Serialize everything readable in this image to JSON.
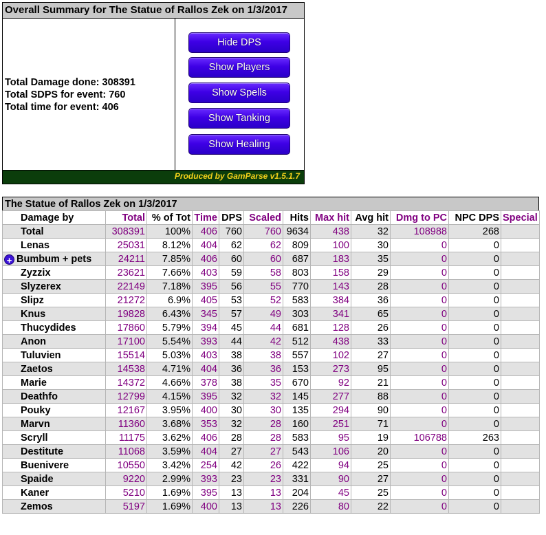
{
  "summary": {
    "title": "Overall Summary for The Statue of Rallos Zek on 1/3/2017",
    "stats": {
      "total_damage": "Total Damage done: 308391",
      "total_sdps": "Total SDPS for event: 760",
      "total_time": "Total time for event: 406"
    },
    "buttons": {
      "hide_dps": "Hide DPS",
      "show_players": "Show Players",
      "show_spells": "Show Spells",
      "show_tanking": "Show Tanking",
      "show_healing": "Show Healing"
    },
    "footer": "Produced by GamParse v1.5.1.7"
  },
  "table": {
    "title": "The Statue of Rallos Zek on 1/3/2017",
    "headers": {
      "damage_by": "Damage by",
      "total": "Total",
      "pct": "% of Tot",
      "time": "Time",
      "dps": "DPS",
      "scaled": "Scaled",
      "hits": "Hits",
      "max_hit": "Max hit",
      "avg_hit": "Avg hit",
      "dmg_to_pc": "Dmg to PC",
      "npc_dps": "NPC DPS",
      "special": "Special"
    },
    "rows": [
      {
        "name": "Total",
        "total": "308391",
        "pct": "100%",
        "time": "406",
        "dps": "760",
        "scaled": "760",
        "hits": "9634",
        "max": "438",
        "avg": "32",
        "dmgpc": "108988",
        "npcdps": "268",
        "special": ""
      },
      {
        "name": "Lenas",
        "total": "25031",
        "pct": "8.12%",
        "time": "404",
        "dps": "62",
        "scaled": "62",
        "hits": "809",
        "max": "100",
        "avg": "30",
        "dmgpc": "0",
        "npcdps": "0",
        "special": ""
      },
      {
        "name": "Bumbum + pets",
        "total": "24211",
        "pct": "7.85%",
        "time": "406",
        "dps": "60",
        "scaled": "60",
        "hits": "687",
        "max": "183",
        "avg": "35",
        "dmgpc": "0",
        "npcdps": "0",
        "special": "",
        "expand": "+"
      },
      {
        "name": "Zyzzix",
        "total": "23621",
        "pct": "7.66%",
        "time": "403",
        "dps": "59",
        "scaled": "58",
        "hits": "803",
        "max": "158",
        "avg": "29",
        "dmgpc": "0",
        "npcdps": "0",
        "special": ""
      },
      {
        "name": "Slyzerex",
        "total": "22149",
        "pct": "7.18%",
        "time": "395",
        "dps": "56",
        "scaled": "55",
        "hits": "770",
        "max": "143",
        "avg": "28",
        "dmgpc": "0",
        "npcdps": "0",
        "special": ""
      },
      {
        "name": "Slipz",
        "total": "21272",
        "pct": "6.9%",
        "time": "405",
        "dps": "53",
        "scaled": "52",
        "hits": "583",
        "max": "384",
        "avg": "36",
        "dmgpc": "0",
        "npcdps": "0",
        "special": ""
      },
      {
        "name": "Knus",
        "total": "19828",
        "pct": "6.43%",
        "time": "345",
        "dps": "57",
        "scaled": "49",
        "hits": "303",
        "max": "341",
        "avg": "65",
        "dmgpc": "0",
        "npcdps": "0",
        "special": ""
      },
      {
        "name": "Thucydides",
        "total": "17860",
        "pct": "5.79%",
        "time": "394",
        "dps": "45",
        "scaled": "44",
        "hits": "681",
        "max": "128",
        "avg": "26",
        "dmgpc": "0",
        "npcdps": "0",
        "special": ""
      },
      {
        "name": "Anon",
        "total": "17100",
        "pct": "5.54%",
        "time": "393",
        "dps": "44",
        "scaled": "42",
        "hits": "512",
        "max": "438",
        "avg": "33",
        "dmgpc": "0",
        "npcdps": "0",
        "special": ""
      },
      {
        "name": "Tuluvien",
        "total": "15514",
        "pct": "5.03%",
        "time": "403",
        "dps": "38",
        "scaled": "38",
        "hits": "557",
        "max": "102",
        "avg": "27",
        "dmgpc": "0",
        "npcdps": "0",
        "special": ""
      },
      {
        "name": "Zaetos",
        "total": "14538",
        "pct": "4.71%",
        "time": "404",
        "dps": "36",
        "scaled": "36",
        "hits": "153",
        "max": "273",
        "avg": "95",
        "dmgpc": "0",
        "npcdps": "0",
        "special": ""
      },
      {
        "name": "Marie",
        "total": "14372",
        "pct": "4.66%",
        "time": "378",
        "dps": "38",
        "scaled": "35",
        "hits": "670",
        "max": "92",
        "avg": "21",
        "dmgpc": "0",
        "npcdps": "0",
        "special": ""
      },
      {
        "name": "Deathfo",
        "total": "12799",
        "pct": "4.15%",
        "time": "395",
        "dps": "32",
        "scaled": "32",
        "hits": "145",
        "max": "277",
        "avg": "88",
        "dmgpc": "0",
        "npcdps": "0",
        "special": ""
      },
      {
        "name": "Pouky",
        "total": "12167",
        "pct": "3.95%",
        "time": "400",
        "dps": "30",
        "scaled": "30",
        "hits": "135",
        "max": "294",
        "avg": "90",
        "dmgpc": "0",
        "npcdps": "0",
        "special": ""
      },
      {
        "name": "Marvn",
        "total": "11360",
        "pct": "3.68%",
        "time": "353",
        "dps": "32",
        "scaled": "28",
        "hits": "160",
        "max": "251",
        "avg": "71",
        "dmgpc": "0",
        "npcdps": "0",
        "special": ""
      },
      {
        "name": "Scryll",
        "total": "11175",
        "pct": "3.62%",
        "time": "406",
        "dps": "28",
        "scaled": "28",
        "hits": "583",
        "max": "95",
        "avg": "19",
        "dmgpc": "106788",
        "npcdps": "263",
        "special": ""
      },
      {
        "name": "Destitute",
        "total": "11068",
        "pct": "3.59%",
        "time": "404",
        "dps": "27",
        "scaled": "27",
        "hits": "543",
        "max": "106",
        "avg": "20",
        "dmgpc": "0",
        "npcdps": "0",
        "special": ""
      },
      {
        "name": "Buenivere",
        "total": "10550",
        "pct": "3.42%",
        "time": "254",
        "dps": "42",
        "scaled": "26",
        "hits": "422",
        "max": "94",
        "avg": "25",
        "dmgpc": "0",
        "npcdps": "0",
        "special": ""
      },
      {
        "name": "Spaide",
        "total": "9220",
        "pct": "2.99%",
        "time": "393",
        "dps": "23",
        "scaled": "23",
        "hits": "331",
        "max": "90",
        "avg": "27",
        "dmgpc": "0",
        "npcdps": "0",
        "special": ""
      },
      {
        "name": "Kaner",
        "total": "5210",
        "pct": "1.69%",
        "time": "395",
        "dps": "13",
        "scaled": "13",
        "hits": "204",
        "max": "45",
        "avg": "25",
        "dmgpc": "0",
        "npcdps": "0",
        "special": ""
      },
      {
        "name": "Zemos",
        "total": "5197",
        "pct": "1.69%",
        "time": "400",
        "dps": "13",
        "scaled": "13",
        "hits": "226",
        "max": "80",
        "avg": "22",
        "dmgpc": "0",
        "npcdps": "0",
        "special": ""
      }
    ]
  }
}
